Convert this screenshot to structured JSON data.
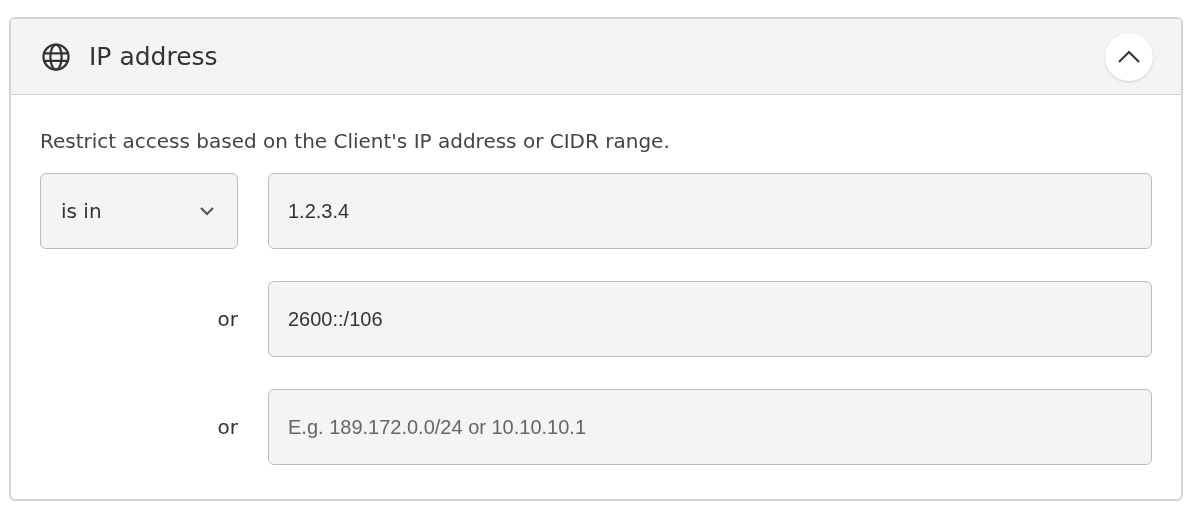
{
  "panel": {
    "title": "IP address",
    "expanded": true,
    "description": "Restrict access based on the Client's IP address or CIDR range.",
    "rows": [
      {
        "kind": "operator",
        "operator": "is in",
        "value": "1.2.3.4"
      },
      {
        "kind": "or",
        "label": "or",
        "value": "2600::/106"
      },
      {
        "kind": "or",
        "label": "or",
        "placeholder": "E.g. 189.172.0.0/24 or 10.10.10.1"
      }
    ]
  }
}
